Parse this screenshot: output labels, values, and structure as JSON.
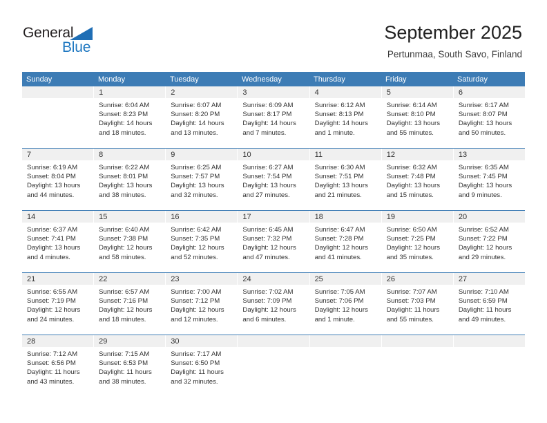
{
  "brand": {
    "name_top": "General",
    "name_bottom": "Blue",
    "triangle_icon": "triangle-icon",
    "color_dark": "#231f20",
    "color_blue": "#1f78c1"
  },
  "header": {
    "title": "September 2025",
    "subtitle": "Pertunmaa, South Savo, Finland"
  },
  "theme": {
    "header_bg": "#3d7cb5",
    "daynum_bg": "#f0f0f0",
    "separator": "#3d7cb5"
  },
  "weekday_headers": [
    "Sunday",
    "Monday",
    "Tuesday",
    "Wednesday",
    "Thursday",
    "Friday",
    "Saturday"
  ],
  "weeks": [
    [
      {
        "day": "",
        "lines": []
      },
      {
        "day": "1",
        "lines": [
          "Sunrise: 6:04 AM",
          "Sunset: 8:23 PM",
          "Daylight: 14 hours",
          "and 18 minutes."
        ]
      },
      {
        "day": "2",
        "lines": [
          "Sunrise: 6:07 AM",
          "Sunset: 8:20 PM",
          "Daylight: 14 hours",
          "and 13 minutes."
        ]
      },
      {
        "day": "3",
        "lines": [
          "Sunrise: 6:09 AM",
          "Sunset: 8:17 PM",
          "Daylight: 14 hours",
          "and 7 minutes."
        ]
      },
      {
        "day": "4",
        "lines": [
          "Sunrise: 6:12 AM",
          "Sunset: 8:13 PM",
          "Daylight: 14 hours",
          "and 1 minute."
        ]
      },
      {
        "day": "5",
        "lines": [
          "Sunrise: 6:14 AM",
          "Sunset: 8:10 PM",
          "Daylight: 13 hours",
          "and 55 minutes."
        ]
      },
      {
        "day": "6",
        "lines": [
          "Sunrise: 6:17 AM",
          "Sunset: 8:07 PM",
          "Daylight: 13 hours",
          "and 50 minutes."
        ]
      }
    ],
    [
      {
        "day": "7",
        "lines": [
          "Sunrise: 6:19 AM",
          "Sunset: 8:04 PM",
          "Daylight: 13 hours",
          "and 44 minutes."
        ]
      },
      {
        "day": "8",
        "lines": [
          "Sunrise: 6:22 AM",
          "Sunset: 8:01 PM",
          "Daylight: 13 hours",
          "and 38 minutes."
        ]
      },
      {
        "day": "9",
        "lines": [
          "Sunrise: 6:25 AM",
          "Sunset: 7:57 PM",
          "Daylight: 13 hours",
          "and 32 minutes."
        ]
      },
      {
        "day": "10",
        "lines": [
          "Sunrise: 6:27 AM",
          "Sunset: 7:54 PM",
          "Daylight: 13 hours",
          "and 27 minutes."
        ]
      },
      {
        "day": "11",
        "lines": [
          "Sunrise: 6:30 AM",
          "Sunset: 7:51 PM",
          "Daylight: 13 hours",
          "and 21 minutes."
        ]
      },
      {
        "day": "12",
        "lines": [
          "Sunrise: 6:32 AM",
          "Sunset: 7:48 PM",
          "Daylight: 13 hours",
          "and 15 minutes."
        ]
      },
      {
        "day": "13",
        "lines": [
          "Sunrise: 6:35 AM",
          "Sunset: 7:45 PM",
          "Daylight: 13 hours",
          "and 9 minutes."
        ]
      }
    ],
    [
      {
        "day": "14",
        "lines": [
          "Sunrise: 6:37 AM",
          "Sunset: 7:41 PM",
          "Daylight: 13 hours",
          "and 4 minutes."
        ]
      },
      {
        "day": "15",
        "lines": [
          "Sunrise: 6:40 AM",
          "Sunset: 7:38 PM",
          "Daylight: 12 hours",
          "and 58 minutes."
        ]
      },
      {
        "day": "16",
        "lines": [
          "Sunrise: 6:42 AM",
          "Sunset: 7:35 PM",
          "Daylight: 12 hours",
          "and 52 minutes."
        ]
      },
      {
        "day": "17",
        "lines": [
          "Sunrise: 6:45 AM",
          "Sunset: 7:32 PM",
          "Daylight: 12 hours",
          "and 47 minutes."
        ]
      },
      {
        "day": "18",
        "lines": [
          "Sunrise: 6:47 AM",
          "Sunset: 7:28 PM",
          "Daylight: 12 hours",
          "and 41 minutes."
        ]
      },
      {
        "day": "19",
        "lines": [
          "Sunrise: 6:50 AM",
          "Sunset: 7:25 PM",
          "Daylight: 12 hours",
          "and 35 minutes."
        ]
      },
      {
        "day": "20",
        "lines": [
          "Sunrise: 6:52 AM",
          "Sunset: 7:22 PM",
          "Daylight: 12 hours",
          "and 29 minutes."
        ]
      }
    ],
    [
      {
        "day": "21",
        "lines": [
          "Sunrise: 6:55 AM",
          "Sunset: 7:19 PM",
          "Daylight: 12 hours",
          "and 24 minutes."
        ]
      },
      {
        "day": "22",
        "lines": [
          "Sunrise: 6:57 AM",
          "Sunset: 7:16 PM",
          "Daylight: 12 hours",
          "and 18 minutes."
        ]
      },
      {
        "day": "23",
        "lines": [
          "Sunrise: 7:00 AM",
          "Sunset: 7:12 PM",
          "Daylight: 12 hours",
          "and 12 minutes."
        ]
      },
      {
        "day": "24",
        "lines": [
          "Sunrise: 7:02 AM",
          "Sunset: 7:09 PM",
          "Daylight: 12 hours",
          "and 6 minutes."
        ]
      },
      {
        "day": "25",
        "lines": [
          "Sunrise: 7:05 AM",
          "Sunset: 7:06 PM",
          "Daylight: 12 hours",
          "and 1 minute."
        ]
      },
      {
        "day": "26",
        "lines": [
          "Sunrise: 7:07 AM",
          "Sunset: 7:03 PM",
          "Daylight: 11 hours",
          "and 55 minutes."
        ]
      },
      {
        "day": "27",
        "lines": [
          "Sunrise: 7:10 AM",
          "Sunset: 6:59 PM",
          "Daylight: 11 hours",
          "and 49 minutes."
        ]
      }
    ],
    [
      {
        "day": "28",
        "lines": [
          "Sunrise: 7:12 AM",
          "Sunset: 6:56 PM",
          "Daylight: 11 hours",
          "and 43 minutes."
        ]
      },
      {
        "day": "29",
        "lines": [
          "Sunrise: 7:15 AM",
          "Sunset: 6:53 PM",
          "Daylight: 11 hours",
          "and 38 minutes."
        ]
      },
      {
        "day": "30",
        "lines": [
          "Sunrise: 7:17 AM",
          "Sunset: 6:50 PM",
          "Daylight: 11 hours",
          "and 32 minutes."
        ]
      },
      {
        "day": "",
        "lines": []
      },
      {
        "day": "",
        "lines": []
      },
      {
        "day": "",
        "lines": []
      },
      {
        "day": "",
        "lines": []
      }
    ]
  ]
}
